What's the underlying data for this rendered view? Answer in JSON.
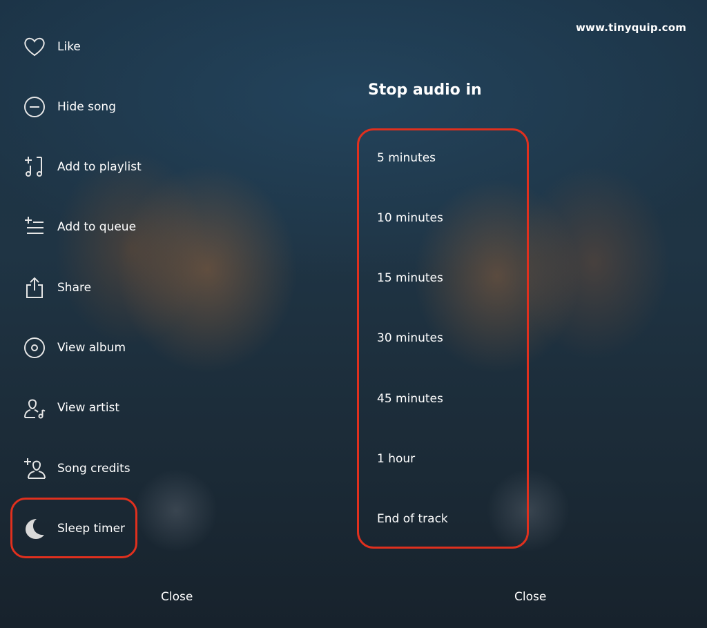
{
  "watermark": "www.tinyquip.com",
  "left_panel": {
    "items": [
      {
        "label": "Like",
        "icon": "heart-icon"
      },
      {
        "label": "Hide song",
        "icon": "minus-circle-icon"
      },
      {
        "label": "Add to playlist",
        "icon": "add-to-playlist-icon"
      },
      {
        "label": "Add to queue",
        "icon": "add-to-queue-icon"
      },
      {
        "label": "Share",
        "icon": "share-icon"
      },
      {
        "label": "View album",
        "icon": "album-icon"
      },
      {
        "label": "View artist",
        "icon": "artist-icon"
      },
      {
        "label": "Song credits",
        "icon": "song-credits-icon"
      },
      {
        "label": "Sleep timer",
        "icon": "moon-icon"
      }
    ],
    "close_label": "Close"
  },
  "right_panel": {
    "title": "Stop audio in",
    "options": [
      "5 minutes",
      "10 minutes",
      "15 minutes",
      "30 minutes",
      "45 minutes",
      "1 hour",
      "End of track"
    ],
    "close_label": "Close"
  },
  "colors": {
    "highlight": "#e0301e",
    "text": "#ffffff",
    "background": "#1d2c39"
  }
}
